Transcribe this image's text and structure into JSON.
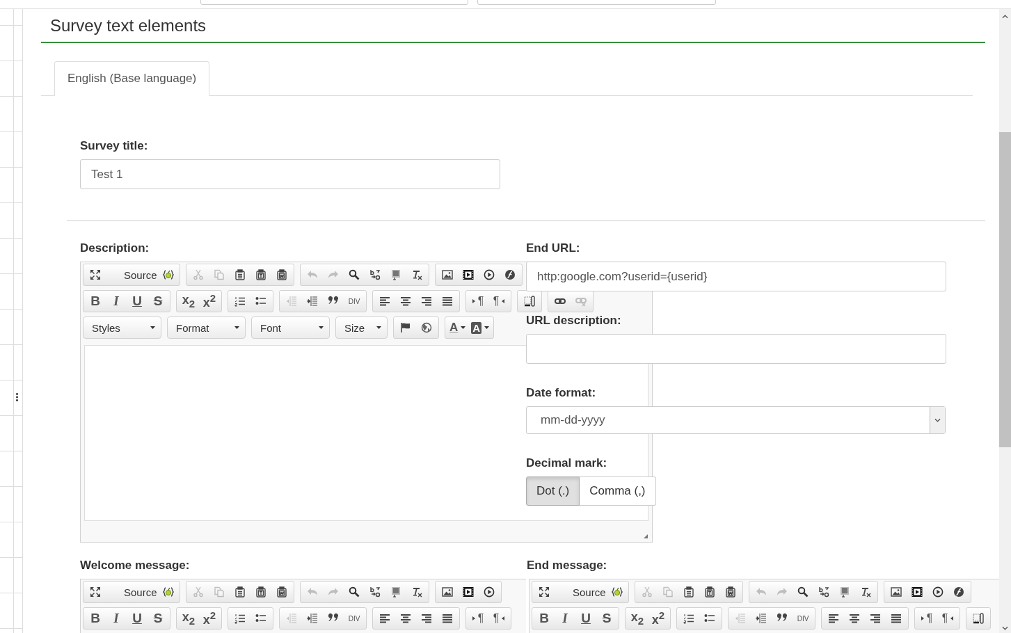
{
  "header": {
    "title": "Survey text elements"
  },
  "tabs": [
    {
      "label": "English (Base language)",
      "selected": true
    }
  ],
  "survey_title": {
    "label": "Survey title:",
    "value": "Test 1"
  },
  "description": {
    "label": "Description:",
    "toolbar": [
      [
        [
          {
            "kind": "maximize",
            "disabled": false
          },
          {
            "kind": "source",
            "label": "Source",
            "disabled": false
          }
        ],
        [
          {
            "kind": "cut",
            "disabled": true
          },
          {
            "kind": "copy",
            "disabled": true
          },
          {
            "kind": "paste",
            "disabled": false
          },
          {
            "kind": "paste_text",
            "disabled": false
          },
          {
            "kind": "paste_word",
            "disabled": false
          }
        ],
        [
          {
            "kind": "undo",
            "disabled": true
          },
          {
            "kind": "redo",
            "disabled": true
          },
          {
            "kind": "find",
            "disabled": false
          },
          {
            "kind": "replace",
            "disabled": false
          },
          {
            "kind": "select_all",
            "disabled": false
          },
          {
            "kind": "remove_format",
            "disabled": false
          }
        ],
        [
          {
            "kind": "image",
            "disabled": false
          },
          {
            "kind": "video",
            "disabled": false
          },
          {
            "kind": "play",
            "disabled": false
          },
          {
            "kind": "flash",
            "disabled": false
          }
        ]
      ],
      [
        [
          {
            "kind": "bold",
            "label": "B",
            "disabled": false
          },
          {
            "kind": "italic",
            "label": "I",
            "disabled": false
          },
          {
            "kind": "underline",
            "label": "U",
            "disabled": false
          },
          {
            "kind": "strike",
            "label": "S",
            "disabled": false
          }
        ],
        [
          {
            "kind": "subscript",
            "label": "x$_{2}$",
            "disabled": false
          },
          {
            "kind": "superscript",
            "label": "x$^{2}$",
            "disabled": false
          }
        ],
        [
          {
            "kind": "numbered_list",
            "disabled": false
          },
          {
            "kind": "bullet_list",
            "disabled": false
          }
        ],
        [
          {
            "kind": "outdent",
            "disabled": true
          },
          {
            "kind": "indent",
            "disabled": false
          },
          {
            "kind": "blockquote",
            "disabled": false
          },
          {
            "kind": "div",
            "label": "DIV",
            "disabled": false
          }
        ],
        [
          {
            "kind": "align_left",
            "disabled": false
          },
          {
            "kind": "align_center",
            "disabled": false
          },
          {
            "kind": "align_right",
            "disabled": false
          },
          {
            "kind": "justify",
            "disabled": false
          }
        ],
        [
          {
            "kind": "ltr",
            "label": "¶",
            "disabled": false
          },
          {
            "kind": "rtl",
            "label": "¶",
            "disabled": false
          }
        ],
        [
          {
            "kind": "show_blocks",
            "disabled": false
          }
        ],
        [
          {
            "kind": "link",
            "disabled": false
          },
          {
            "kind": "unlink",
            "disabled": true
          }
        ]
      ],
      [
        [
          {
            "kind": "dropdown",
            "label": "Styles",
            "disabled": false
          }
        ],
        [
          {
            "kind": "dropdown",
            "label": "Format",
            "disabled": false
          }
        ],
        [
          {
            "kind": "dropdown",
            "label": "Font",
            "disabled": false
          }
        ],
        [
          {
            "kind": "dropdown",
            "label": "Size",
            "disabled": false
          }
        ],
        [
          {
            "kind": "anchor",
            "disabled": false
          },
          {
            "kind": "globe",
            "disabled": false
          }
        ],
        [
          {
            "kind": "text_color",
            "label": "A",
            "disabled": false
          },
          {
            "kind": "bg_color",
            "label": "A",
            "disabled": false
          }
        ]
      ]
    ]
  },
  "end_url": {
    "label": "End URL:",
    "value": "http:google.com?userid={userid}"
  },
  "url_description": {
    "label": "URL description:"
  },
  "date_format": {
    "label": "Date format:",
    "value": "mm-dd-yyyy"
  },
  "decimal_mark": {
    "label": "Decimal mark:",
    "options": [
      {
        "label": "Dot (.)",
        "selected": true
      },
      {
        "label": "Comma (,)",
        "selected": false
      }
    ]
  },
  "welcome_message": {
    "label": "Welcome message:",
    "toolbar": [
      [
        [
          {
            "kind": "maximize",
            "disabled": false
          },
          {
            "kind": "source",
            "label": "Source",
            "disabled": false
          }
        ],
        [
          {
            "kind": "cut",
            "disabled": true
          },
          {
            "kind": "copy",
            "disabled": true
          },
          {
            "kind": "paste",
            "disabled": false
          },
          {
            "kind": "paste_text",
            "disabled": false
          },
          {
            "kind": "paste_word",
            "disabled": false
          }
        ],
        [
          {
            "kind": "undo",
            "disabled": true
          },
          {
            "kind": "redo",
            "disabled": true
          },
          {
            "kind": "find",
            "disabled": false
          },
          {
            "kind": "replace",
            "disabled": false
          },
          {
            "kind": "select_all",
            "disabled": false
          },
          {
            "kind": "remove_format",
            "disabled": false
          }
        ],
        [
          {
            "kind": "image",
            "disabled": false
          },
          {
            "kind": "video",
            "disabled": false
          },
          {
            "kind": "play",
            "disabled": false
          }
        ]
      ],
      [
        [
          {
            "kind": "bold",
            "label": "B",
            "disabled": false
          },
          {
            "kind": "italic",
            "label": "I",
            "disabled": false
          },
          {
            "kind": "underline",
            "label": "U",
            "disabled": false
          },
          {
            "kind": "strike",
            "label": "S",
            "disabled": false
          }
        ],
        [
          {
            "kind": "subscript",
            "label": "x$_{2}$",
            "disabled": false
          },
          {
            "kind": "superscript",
            "label": "x$^{2}$",
            "disabled": false
          }
        ],
        [
          {
            "kind": "numbered_list",
            "disabled": false
          },
          {
            "kind": "bullet_list",
            "disabled": false
          }
        ],
        [
          {
            "kind": "outdent",
            "disabled": true
          },
          {
            "kind": "indent",
            "disabled": false
          },
          {
            "kind": "blockquote",
            "disabled": false
          },
          {
            "kind": "div",
            "label": "DIV",
            "disabled": false
          }
        ],
        [
          {
            "kind": "align_left",
            "disabled": false
          },
          {
            "kind": "align_center",
            "disabled": false
          },
          {
            "kind": "align_right",
            "disabled": false
          },
          {
            "kind": "justify",
            "disabled": false
          }
        ],
        [
          {
            "kind": "ltr",
            "label": "¶",
            "disabled": false
          },
          {
            "kind": "rtl",
            "label": "¶",
            "disabled": false
          }
        ]
      ]
    ]
  },
  "end_message": {
    "label": "End message:",
    "toolbar": [
      [
        [
          {
            "kind": "maximize",
            "disabled": false
          },
          {
            "kind": "source",
            "label": "Source",
            "disabled": false
          }
        ],
        [
          {
            "kind": "cut",
            "disabled": true
          },
          {
            "kind": "copy",
            "disabled": true
          },
          {
            "kind": "paste",
            "disabled": false
          },
          {
            "kind": "paste_text",
            "disabled": false
          },
          {
            "kind": "paste_word",
            "disabled": false
          }
        ],
        [
          {
            "kind": "undo",
            "disabled": true
          },
          {
            "kind": "redo",
            "disabled": true
          },
          {
            "kind": "find",
            "disabled": false
          },
          {
            "kind": "replace",
            "disabled": false
          },
          {
            "kind": "select_all",
            "disabled": false
          },
          {
            "kind": "remove_format",
            "disabled": false
          }
        ],
        [
          {
            "kind": "image",
            "disabled": false
          },
          {
            "kind": "video",
            "disabled": false
          },
          {
            "kind": "play",
            "disabled": false
          },
          {
            "kind": "flash",
            "disabled": false
          }
        ]
      ],
      [
        [
          {
            "kind": "bold",
            "label": "B",
            "disabled": false
          },
          {
            "kind": "italic",
            "label": "I",
            "disabled": false
          },
          {
            "kind": "underline",
            "label": "U",
            "disabled": false
          },
          {
            "kind": "strike",
            "label": "S",
            "disabled": false
          }
        ],
        [
          {
            "kind": "subscript",
            "label": "x$_{2}$",
            "disabled": false
          },
          {
            "kind": "superscript",
            "label": "x$^{2}$",
            "disabled": false
          }
        ],
        [
          {
            "kind": "numbered_list",
            "disabled": false
          },
          {
            "kind": "bullet_list",
            "disabled": false
          }
        ],
        [
          {
            "kind": "outdent",
            "disabled": true
          },
          {
            "kind": "indent",
            "disabled": false
          },
          {
            "kind": "blockquote",
            "disabled": false
          },
          {
            "kind": "div",
            "label": "DIV",
            "disabled": false
          }
        ],
        [
          {
            "kind": "align_left",
            "disabled": false
          },
          {
            "kind": "align_center",
            "disabled": false
          },
          {
            "kind": "align_right",
            "disabled": false
          },
          {
            "kind": "justify",
            "disabled": false
          }
        ],
        [
          {
            "kind": "ltr",
            "label": "¶",
            "disabled": false
          },
          {
            "kind": "rtl",
            "label": "¶",
            "disabled": false
          }
        ],
        [
          {
            "kind": "show_blocks",
            "disabled": false
          }
        ]
      ]
    ]
  }
}
